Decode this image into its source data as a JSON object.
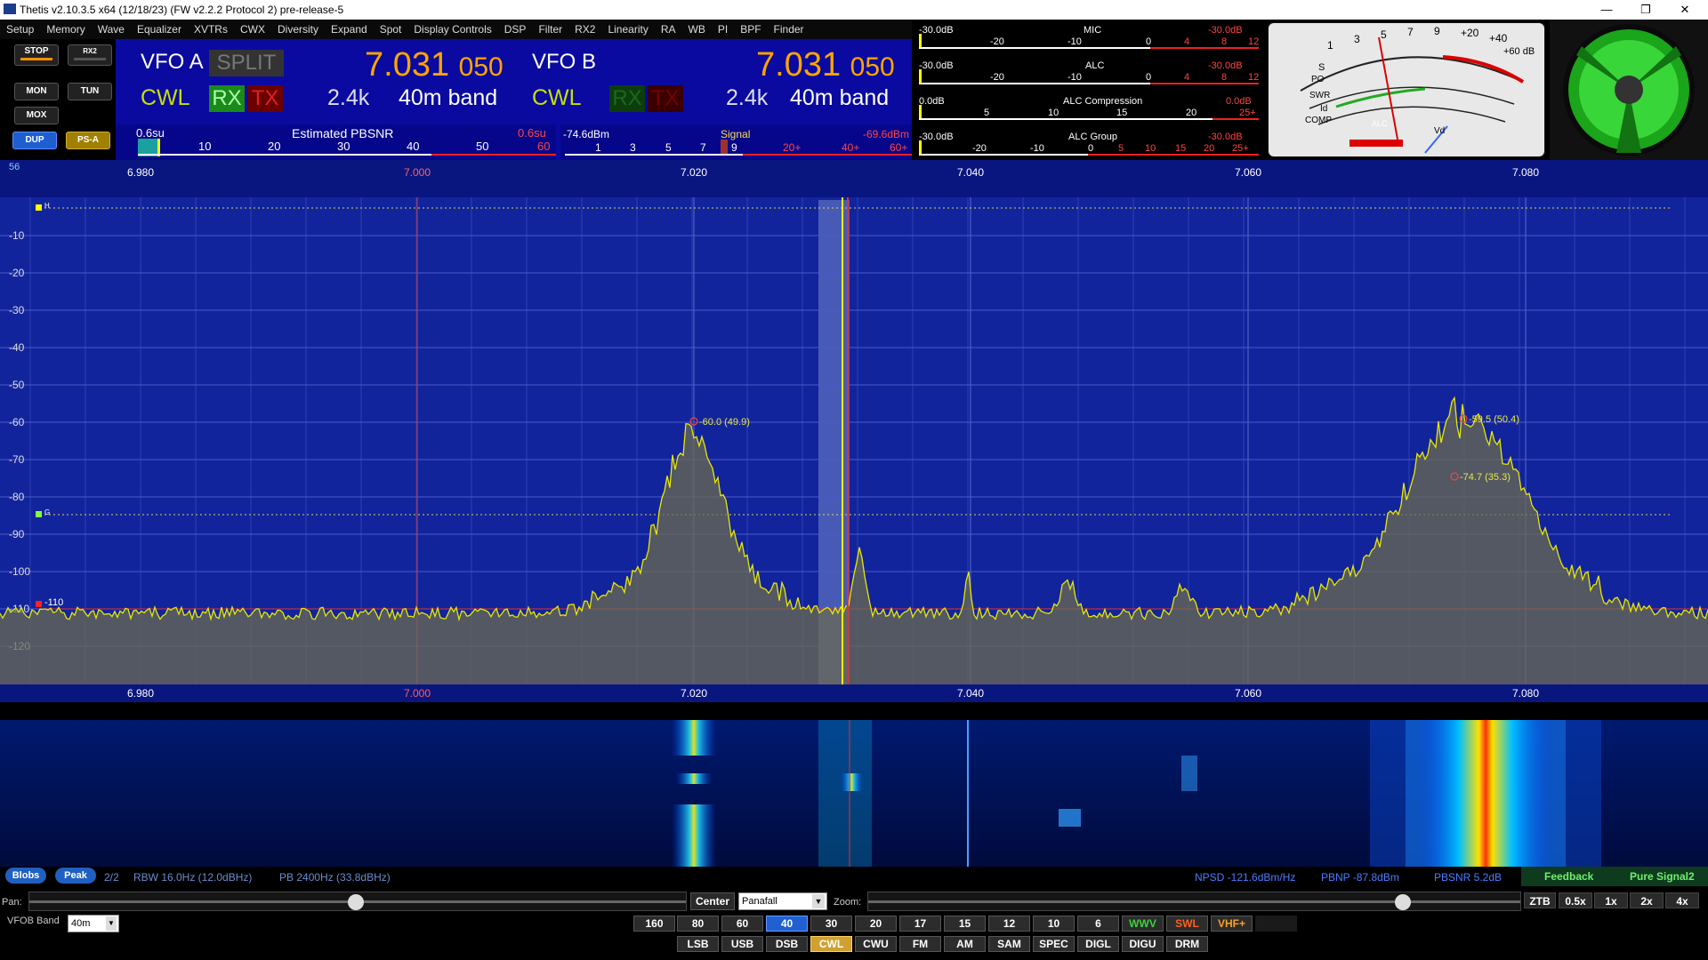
{
  "window": {
    "title": "Thetis v2.10.3.5 x64 (12/18/23) (FW v2.2.2 Protocol 2) pre-release-5"
  },
  "menu": [
    "Setup",
    "Memory",
    "Wave",
    "Equalizer",
    "XVTRs",
    "CWX",
    "Diversity",
    "Expand",
    "Spot",
    "Display Controls",
    "DSP",
    "Filter",
    "RX2",
    "Linearity",
    "RA",
    "WB",
    "PI",
    "BPF",
    "Finder"
  ],
  "left_buttons": {
    "stop": "STOP",
    "rx2": "RX2",
    "mon": "MON",
    "tun": "TUN",
    "mox": "MOX",
    "dup": "DUP",
    "psa": "PS-A"
  },
  "vfo_a": {
    "label": "VFO A",
    "split": "SPLIT",
    "mode": "CWL",
    "rx": "RX",
    "tx": "TX",
    "freq_main": "7.031",
    "freq_sub": "050",
    "bw": "2.4k",
    "band": "40m band"
  },
  "vfo_b": {
    "label": "VFO B",
    "mode": "CWL",
    "rx": "RX",
    "tx": "TX",
    "freq_main": "7.031",
    "freq_sub": "050",
    "bw": "2.4k",
    "band": "40m band"
  },
  "pbsnr_scale": {
    "left": "0.6su",
    "title": "Estimated PBSNR",
    "right": "0.6su",
    "ticks": [
      "10",
      "20",
      "30",
      "40",
      "50",
      "60"
    ]
  },
  "signal_scale": {
    "left": "-74.6dBm",
    "title": "Signal",
    "right": "-69.6dBm",
    "ticks": [
      "1",
      "3",
      "5",
      "7",
      "9",
      "20+",
      "40+",
      "60+"
    ]
  },
  "meters": [
    {
      "name": "MIC",
      "left": "-30.0dB",
      "right": "-30.0dB",
      "ticks": [
        "-20",
        "-10",
        "0",
        "4",
        "8",
        "12"
      ]
    },
    {
      "name": "ALC",
      "left": "-30.0dB",
      "right": "-30.0dB",
      "ticks": [
        "-20",
        "-10",
        "0",
        "4",
        "8",
        "12"
      ]
    },
    {
      "name": "ALC Compression",
      "left": "0.0dB",
      "right": "0.0dB",
      "ticks": [
        "5",
        "10",
        "15",
        "20",
        "25+"
      ]
    },
    {
      "name": "ALC Group",
      "left": "-30.0dB",
      "right": "-30.0dB",
      "ticks": [
        "-20",
        "-10",
        "0",
        "5",
        "10",
        "15",
        "20",
        "25+"
      ]
    }
  ],
  "analog_meter": {
    "labels": [
      "S",
      "PO",
      "SWR",
      "Id",
      "COMP",
      "ALC",
      "Vd"
    ],
    "top_ticks": [
      "1",
      "3",
      "5",
      "7",
      "9",
      "+20",
      "+40",
      "+60 dB"
    ]
  },
  "panadapter": {
    "corner": "56",
    "freq_labels": [
      "6.980",
      "7.000",
      "7.020",
      "7.040",
      "7.060",
      "7.080"
    ],
    "db_labels": [
      "-10",
      "-20",
      "-30",
      "-40",
      "-50",
      "-60",
      "-70",
      "-80",
      "-90",
      "-100",
      "-110",
      "-120"
    ],
    "markers": {
      "h": "H",
      "g": "G",
      "noise": "-110"
    },
    "peaks": [
      {
        "label": "-60.0 (49.9)"
      },
      {
        "label": "-59.5 (50.4)"
      },
      {
        "label": "-74.7 (35.3)"
      }
    ]
  },
  "status": {
    "blobs": "Blobs",
    "peak": "Peak",
    "count": "2/2",
    "rbw": "RBW 16.0Hz (12.0dBHz)",
    "pb": "PB 2400Hz (33.8dBHz)",
    "npsd": "NPSD -121.6dBm/Hz",
    "pbnp": "PBNP -87.8dBm",
    "pbsnr": "PBSNR 5.2dB",
    "feedback": "Feedback",
    "puresignal": "Pure Signal2"
  },
  "controls": {
    "pan_label": "Pan:",
    "center": "Center",
    "display_mode": "Panafall",
    "zoom_label": "Zoom:",
    "ztb": "ZTB",
    "zooms": [
      "0.5x",
      "1x",
      "2x",
      "4x"
    ],
    "vfob_band_label": "VFOB Band",
    "vfob_band": "40m"
  },
  "bands": [
    "160",
    "80",
    "60",
    "40",
    "30",
    "20",
    "17",
    "15",
    "12",
    "10",
    "6",
    "WWV",
    "SWL",
    "VHF+"
  ],
  "modes": [
    "LSB",
    "USB",
    "DSB",
    "CWL",
    "CWU",
    "FM",
    "AM",
    "SAM",
    "SPEC",
    "DIGL",
    "DIGU",
    "DRM"
  ],
  "colors": {
    "vfo_bg": "#0a0aa0",
    "freq": "#ffa500",
    "cwl": "#c8e000",
    "trace": "#e8e800",
    "pan_bg": "#12249c"
  }
}
